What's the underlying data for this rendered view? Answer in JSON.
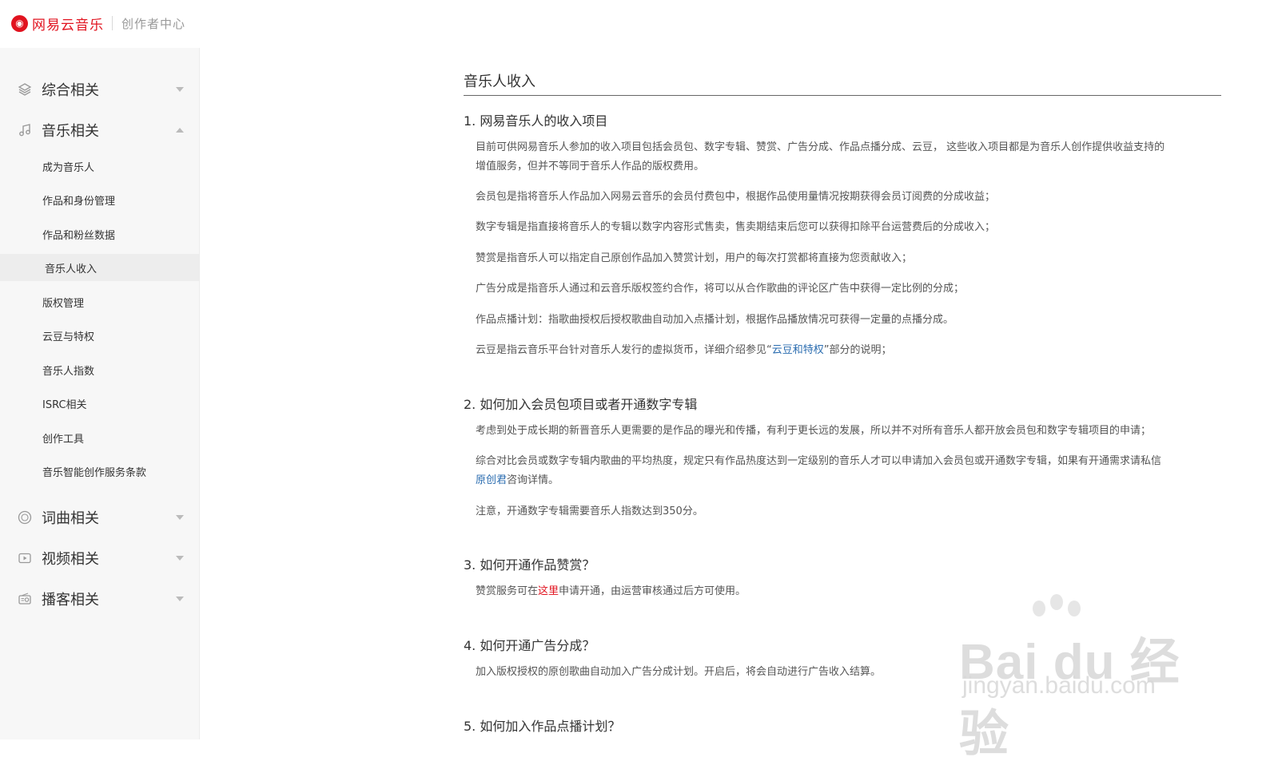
{
  "header": {
    "brand": "网易云音乐",
    "subtitle": "创作者中心"
  },
  "sidebar": {
    "groups": [
      {
        "label": "综合相关",
        "icon": "layers-icon"
      },
      {
        "label": "音乐相关",
        "icon": "music-note-icon"
      },
      {
        "label": "词曲相关",
        "icon": "lyrics-icon"
      },
      {
        "label": "视频相关",
        "icon": "video-icon"
      },
      {
        "label": "播客相关",
        "icon": "radio-icon"
      }
    ],
    "sub_items": [
      "成为音乐人",
      "作品和身份管理",
      "作品和粉丝数据",
      "音乐人收入",
      "版权管理",
      "云豆与特权",
      "音乐人指数",
      "ISRC相关",
      "创作工具",
      "音乐智能创作服务条款"
    ]
  },
  "content": {
    "title": "音乐人收入",
    "sections": [
      {
        "title": "1. 网易音乐人的收入项目",
        "p1": "目前可供网易音乐人参加的收入项目包括会员包、数字专辑、赞赏、广告分成、作品点播分成、云豆， 这些收入项目都是为音乐人创作提供收益支持的",
        "p1b": "增值服务，但并不等同于音乐人作品的版权费用。",
        "p2": "会员包是指将音乐人作品加入网易云音乐的会员付费包中，根据作品使用量情况按期获得会员订阅费的分成收益；",
        "p3": "数字专辑是指直接将音乐人的专辑以数字内容形式售卖，售卖期结束后您可以获得扣除平台运营费后的分成收入；",
        "p4": "赞赏是指音乐人可以指定自己原创作品加入赞赏计划，用户的每次打赏都将直接为您贡献收入；",
        "p5": "广告分成是指音乐人通过和云音乐版权签约合作，将可以从合作歌曲的评论区广告中获得一定比例的分成；",
        "p6": "作品点播计划：指歌曲授权后授权歌曲自动加入点播计划，根据作品播放情况可获得一定量的点播分成。",
        "p7_pre": "云豆是指云音乐平台针对音乐人发行的虚拟货币，详细介绍参见“",
        "p7_link": "云豆和特权",
        "p7_post": "”部分的说明；"
      },
      {
        "title": "2. 如何加入会员包项目或者开通数字专辑",
        "p1": "考虑到处于成长期的新晋音乐人更需要的是作品的曝光和传播，有利于更长远的发展，所以并不对所有音乐人都开放会员包和数字专辑项目的申请；",
        "p2": "综合对比会员或数字专辑内歌曲的平均热度，规定只有作品热度达到一定级别的音乐人才可以申请加入会员包或开通数字专辑，如果有开通需求请私信",
        "p2_link": "原创君",
        "p2_post": "咨询详情。",
        "p3": "注意，开通数字专辑需要音乐人指数达到350分。"
      },
      {
        "title": "3. 如何开通作品赞赏？",
        "p1_pre": "赞赏服务可在",
        "p1_link": "这里",
        "p1_post": "申请开通，由运营审核通过后方可使用。"
      },
      {
        "title": "4. 如何开通广告分成？",
        "p1": "加入版权授权的原创歌曲自动加入广告分成计划。开启后，将会自动进行广告收入结算。"
      },
      {
        "title": "5. 如何加入作品点播计划？"
      }
    ]
  },
  "watermark": {
    "main": "Bai du 经验",
    "sub": "jingyan.baidu.com"
  },
  "colors": {
    "brand": "#e1131f",
    "link": "#2b6db0",
    "sidebar_bg": "#f7f7f7"
  }
}
